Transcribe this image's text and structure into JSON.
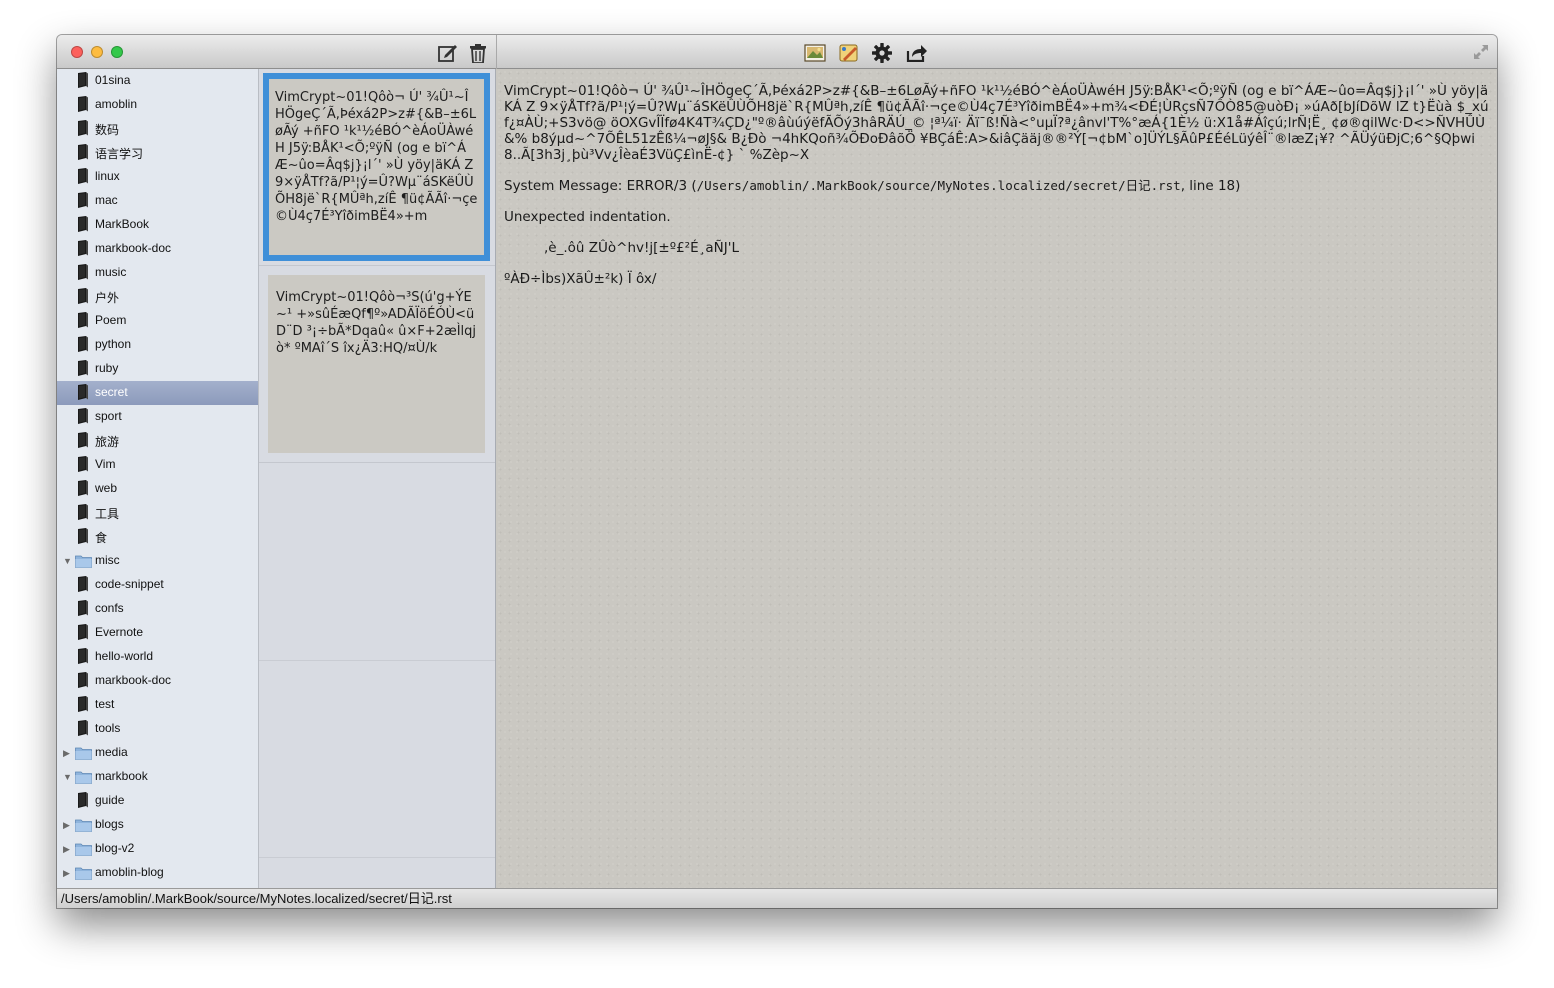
{
  "sidebar": {
    "items": [
      {
        "label": "01sina",
        "icon": "book-icon",
        "disclosure": ""
      },
      {
        "label": "amoblin",
        "icon": "book-icon",
        "disclosure": ""
      },
      {
        "label": "数码",
        "icon": "book-icon",
        "disclosure": ""
      },
      {
        "label": "语言学习",
        "icon": "book-icon",
        "disclosure": ""
      },
      {
        "label": "linux",
        "icon": "book-icon",
        "disclosure": ""
      },
      {
        "label": "mac",
        "icon": "book-icon",
        "disclosure": ""
      },
      {
        "label": "MarkBook",
        "icon": "book-icon",
        "disclosure": ""
      },
      {
        "label": "markbook-doc",
        "icon": "book-icon",
        "disclosure": ""
      },
      {
        "label": "music",
        "icon": "book-icon",
        "disclosure": ""
      },
      {
        "label": "户外",
        "icon": "book-icon",
        "disclosure": ""
      },
      {
        "label": "Poem",
        "icon": "book-icon",
        "disclosure": ""
      },
      {
        "label": "python",
        "icon": "book-icon",
        "disclosure": ""
      },
      {
        "label": "ruby",
        "icon": "book-icon",
        "disclosure": ""
      },
      {
        "label": "secret",
        "icon": "book-icon",
        "disclosure": "",
        "selected": true
      },
      {
        "label": "sport",
        "icon": "book-icon",
        "disclosure": ""
      },
      {
        "label": "旅游",
        "icon": "book-icon",
        "disclosure": ""
      },
      {
        "label": "Vim",
        "icon": "book-icon",
        "disclosure": ""
      },
      {
        "label": "web",
        "icon": "book-icon",
        "disclosure": ""
      },
      {
        "label": "工具",
        "icon": "book-icon",
        "disclosure": ""
      },
      {
        "label": "食",
        "icon": "book-icon",
        "disclosure": ""
      },
      {
        "label": "misc",
        "icon": "folder-icon",
        "disclosure": "expanded"
      },
      {
        "label": "code-snippet",
        "icon": "book-icon",
        "disclosure": ""
      },
      {
        "label": "confs",
        "icon": "book-icon",
        "disclosure": ""
      },
      {
        "label": "Evernote",
        "icon": "book-icon",
        "disclosure": ""
      },
      {
        "label": "hello-world",
        "icon": "book-icon",
        "disclosure": ""
      },
      {
        "label": "markbook-doc",
        "icon": "book-icon",
        "disclosure": ""
      },
      {
        "label": "test",
        "icon": "book-icon",
        "disclosure": ""
      },
      {
        "label": "tools",
        "icon": "book-icon",
        "disclosure": ""
      },
      {
        "label": "media",
        "icon": "folder-icon",
        "disclosure": "collapsed"
      },
      {
        "label": "markbook",
        "icon": "folder-icon",
        "disclosure": "expanded"
      },
      {
        "label": "guide",
        "icon": "book-icon",
        "disclosure": ""
      },
      {
        "label": "blogs",
        "icon": "folder-icon",
        "disclosure": "collapsed"
      },
      {
        "label": "blog-v2",
        "icon": "folder-icon",
        "disclosure": "collapsed"
      },
      {
        "label": "amoblin-blog",
        "icon": "folder-icon",
        "disclosure": "collapsed"
      }
    ]
  },
  "notelist": {
    "notes": [
      {
        "preview": "VimCrypt~01!Qôò¬ Ú' ¾Û¹~ÎHÖgeÇ´Ã,Þéxá2P>z#{&B–±6LøÃý +ñFO ¹k¹½éBÓ^èÁoÜÀwéH J5ÿ:BÅK¹<Õ;ºÿÑ (og e bï^ÁÆ~ûo=Âq$j}¡l´' »Ù yöy|äKÁ Z 9×ÿÅTf?ã/P¹¦ý=Û?Wµ¨áSKëÛÙÕH8jë`R{MÛªh,zíÊ ¶ü¢ÃÃî·¬çe©Ù4ç7É³YîðimBË4»+m",
        "selected": true
      },
      {
        "preview": "VimCrypt~01!Qôò¬³S(ú'g+ÝE~¹ +»sûÉæQf¶º»ADÃÏöÉÓÙ<üD¨D ³¡÷bÃ*Dqaû« û×F+2æÌlqjò* ºMAî´S îx¿Ä3:HQ/¤Ù/k",
        "selected": false
      }
    ]
  },
  "content": {
    "garbled_text": "VimCrypt~01!Qôò¬ Ú' ¾Û¹~ÎHÖgeÇ´Ã,Þéxá2P>z#{&B–±6LøÃý+ñFO ¹k¹½éBÓ^èÁoÜÀwéH J5ÿ:BÅK¹<Õ;ºÿÑ (og e bï^ÁÆ~ûo=Âq$j}¡l´' »Ù yöy|äKÁ Z 9×ÿÅTf?ã/P¹¦ý=Û?Wµ¨áSKëÛÙÕH8jë`R{MÛªh,zíÊ ¶ü¢ÃÃî·¬çe©Ù4ç7É³YîðimBË4»+m¾<ÐÉ¦ÙRçsÑ7ÔÒ85@uòÐ¡ »úAð[bJíDõW lZ t}Ëùà $_xúf¿¤ÀÙ;+S3vö@ öOXGvÎÏfø4K4T¾ÇD¿\"º®âùúýëfÃÕý3hâRÄÚ_© ¦ª¼ï· Äï¯ß!Ñà<°uµÏ?ª¿ânvl'T%°æÁ{1È½ ü:X1å#Áîçú;lrÑ¦Ë¸ ¢ø®qilWc·D<>ÑVHÛÙ&% b8ýµd~^7ÕÊL51zÊß¼¬øJ§& B¿Ðò ¬4hKQoñ¾ÕÐoÐâõÖ ¥BÇáÊ:A>&iâÇääj®®²Ý[¬¢bM`o]ÜÝL§ÃûP£ÉéLüýêÎ¨®læZ¡¥? ^ÃÜýüÐjC;6^§Qþwi8..Ã[3h3j¸þù³Vv¿ÎèaÉ3VüÇ£ìnË-¢} ` %Zèp~X",
    "system_message_prefix": "System Message: ERROR/3 (",
    "system_message_path": "/Users/amoblin/.MarkBook/source/MyNotes.localized/secret/日记.rst",
    "system_message_suffix": ", line 18)",
    "error_detail": "Unexpected indentation.",
    "indented_text": ",è_.ôû ZÛò^hv!j[±º£²É¸aÑJ'L",
    "trailing_text": "ºÀÐ÷Ìbs)XãÛ±²k) Ï ôx/"
  },
  "statusbar": {
    "path": "/Users/amoblin/.MarkBook/source/MyNotes.localized/secret/日记.rst"
  },
  "toolbar": {
    "left_buttons": [
      "compose-icon",
      "trash-icon"
    ],
    "center_buttons": [
      "preview-image-icon",
      "edit-theme-icon",
      "gear-icon",
      "share-icon"
    ]
  },
  "colors": {
    "close": "#fc605c",
    "minimize": "#fdbc40",
    "zoom": "#34c84a",
    "selection_blue": "#3f8fd8",
    "sidebar_selected": "#98a5c3"
  }
}
